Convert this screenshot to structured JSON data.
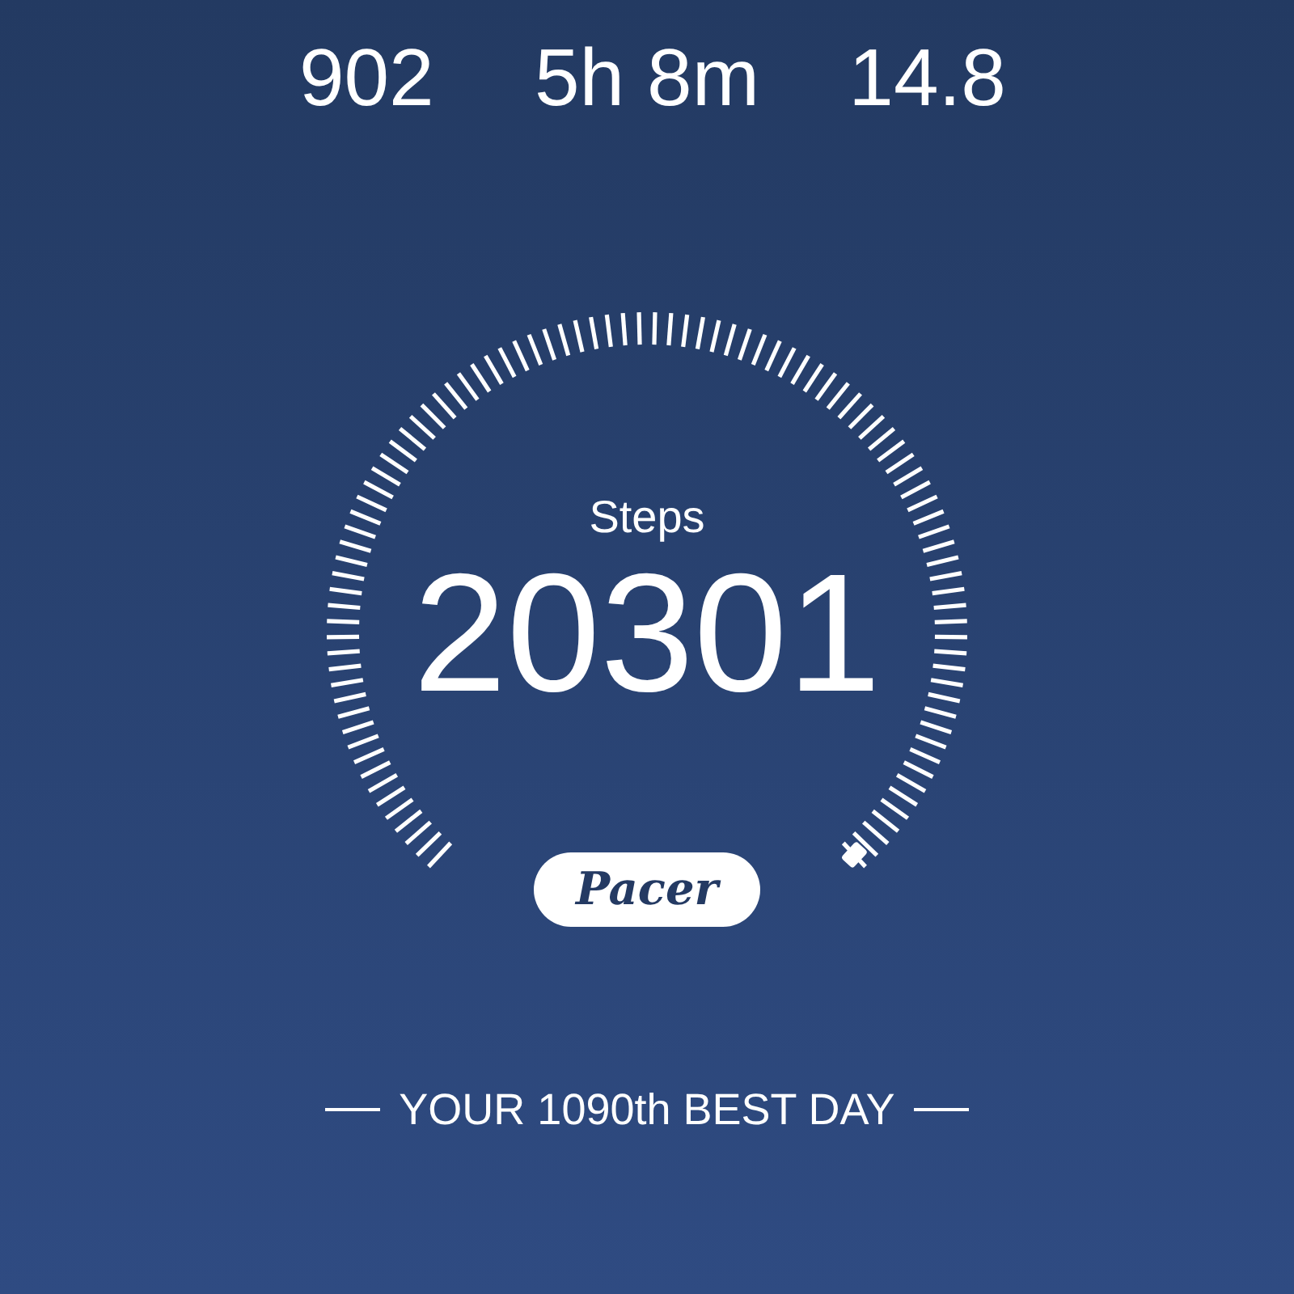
{
  "stats": [
    {
      "value": "902"
    },
    {
      "value": "5h 8m"
    },
    {
      "value": "14.8"
    }
  ],
  "gauge": {
    "label": "Steps",
    "value": "20301"
  },
  "logo": "Pacer",
  "rank": "YOUR 1090th BEST DAY"
}
